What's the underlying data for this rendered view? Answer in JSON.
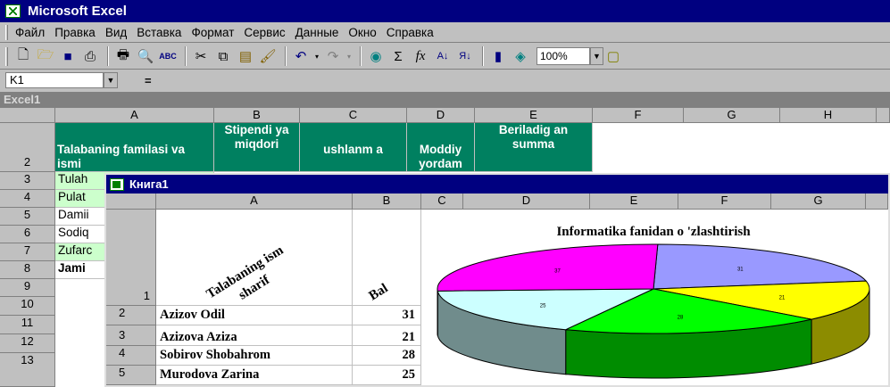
{
  "app": {
    "title": "Microsoft Excel"
  },
  "menu": [
    "Файл",
    "Правка",
    "Вид",
    "Вставка",
    "Формат",
    "Сервис",
    "Данные",
    "Окно",
    "Справка"
  ],
  "toolbar": {
    "zoom": "100%"
  },
  "formula": {
    "cell_ref": "K1",
    "eq": "="
  },
  "workbook1": {
    "title": "Excel1",
    "columns": [
      "A",
      "B",
      "C",
      "D",
      "E",
      "F",
      "G",
      "H"
    ],
    "rows": [
      "2",
      "3",
      "4",
      "5",
      "6",
      "7",
      "8",
      "9",
      "10",
      "11",
      "12",
      "13"
    ],
    "header_cells": [
      "Talabaning familasi va ismi",
      "Stipendi ya miqdori",
      "ushlanm a",
      "Moddiy yordam",
      "Beriladig an summa"
    ],
    "names": [
      "Tulah",
      "Pulat",
      "Damii",
      "Sodiq",
      "Zufarc",
      "Jami"
    ]
  },
  "workbook2": {
    "title": "Книга1",
    "columns": [
      "A",
      "B",
      "C",
      "D",
      "E",
      "F",
      "G"
    ],
    "rows": [
      "1",
      "2",
      "3",
      "4",
      "5"
    ],
    "header_a": "Talabaning ism sharif",
    "header_b": "Bal",
    "students": [
      {
        "name": "Azizov Odil",
        "score": "31"
      },
      {
        "name": "Azizova Aziza",
        "score": "21"
      },
      {
        "name": "Sobirov Shobahrom",
        "score": "28"
      },
      {
        "name": "Murodova Zarina",
        "score": "25"
      }
    ]
  },
  "chart_data": {
    "type": "pie",
    "title": "Informatika fanidan o 'zlashtirish",
    "slices": [
      {
        "value": 31,
        "color": "#9999ff"
      },
      {
        "value": 21,
        "color": "#ffff00"
      },
      {
        "value": 28,
        "color": "#00ff00"
      },
      {
        "value": 25,
        "color": "#ccffff"
      },
      {
        "value": 37,
        "color": "#ff00ff"
      }
    ],
    "data_labels": [
      "31",
      "21",
      "28",
      "25",
      "37"
    ]
  }
}
